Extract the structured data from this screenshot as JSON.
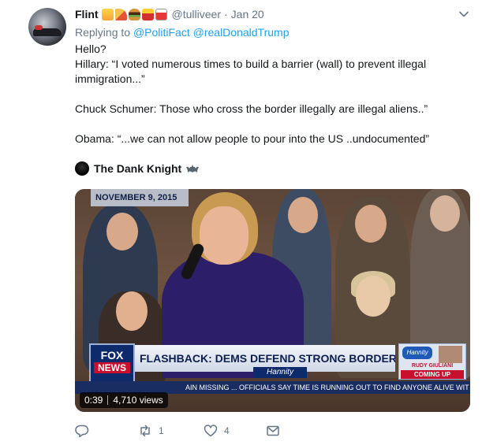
{
  "tweet": {
    "display_name": "Flint",
    "handle": "@tulliveer",
    "separator": "·",
    "date": "Jan 20",
    "reply_prefix": "Replying to",
    "reply_targets": [
      "@PolitiFact",
      "@realDonaldTrump"
    ],
    "text_lines": [
      "Hello?",
      "Hillary: “I voted numerous times to build a barrier (wall) to prevent illegal",
      "immigration...”",
      "",
      "Chuck Schumer: Those who cross the border illegally are illegal aliens..”",
      "",
      "Obama: “...we can not allow people to pour into the US ..undocumented”"
    ],
    "media_credit": "The Dank Knight",
    "icons": {
      "caret": "chevron-down-icon",
      "reply": "reply-icon",
      "retweet": "retweet-icon",
      "like": "heart-icon",
      "message": "envelope-icon",
      "credit_emoji": "bat-icon"
    },
    "colors": {
      "link": "#1da1f2",
      "muted": "#657786",
      "text": "#14171a"
    }
  },
  "video": {
    "location_date": "NOVEMBER 9, 2015",
    "network": "FOX",
    "network_sub": "NEWS",
    "headline": "FLASHBACK: DEMS DEFEND STRONG BORDER STANCE",
    "show_tag": "Hannity",
    "guest_logo": "Hannity",
    "guest_name": "RUDY GIULIANI",
    "coming_up": "COMING UP",
    "ticker": "AIN MISSING ...  OFFICIALS SAY TIME IS RUNNING OUT TO FIND ANYONE ALIVE  WIT",
    "duration": "0:39",
    "views": "4,710 views"
  },
  "actions": {
    "reply_count": "",
    "retweet_count": "1",
    "like_count": "4"
  }
}
